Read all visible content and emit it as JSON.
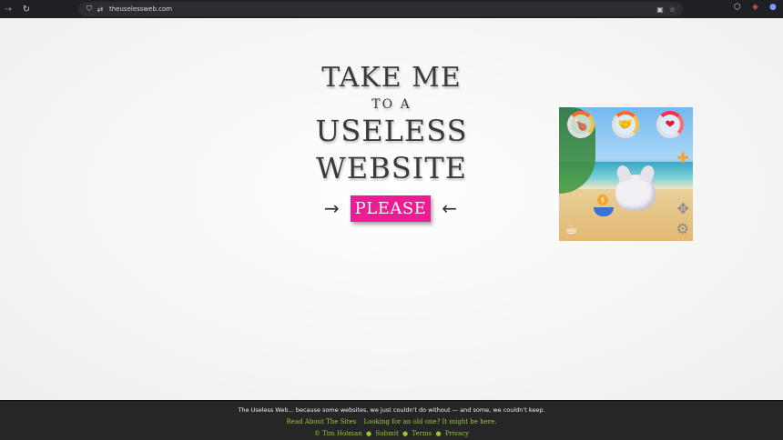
{
  "browser": {
    "url": "theuselessweb.com",
    "icons": {
      "back": "arrow-right-icon",
      "reload": "reload-icon",
      "security": "shield-icon",
      "site_settings": "tune-icon",
      "install": "install-icon",
      "bookmark": "star-icon",
      "extensions": "puzzle-icon"
    }
  },
  "hero": {
    "line1": "TAKE ME",
    "line2": "TO A",
    "line3": "USELESS",
    "line4": "WEBSITE",
    "button_label": "PLEASE",
    "arrow_left": "→",
    "arrow_right": "←"
  },
  "colors": {
    "button": "#ee1c92",
    "footer_bg": "#262626",
    "footer_link": "#96c43d"
  },
  "footer": {
    "tagline": "The Useless Web... because some websites, we just couldn't do without — and some, we couldn't keep.",
    "link_about": "Read About The Sites",
    "link_old": "Looking for an old one? It might be here.",
    "copyright": "© Tim Holman",
    "link_submit": "Submit",
    "link_terms": "Terms",
    "link_privacy": "Privacy",
    "separator": "●"
  }
}
